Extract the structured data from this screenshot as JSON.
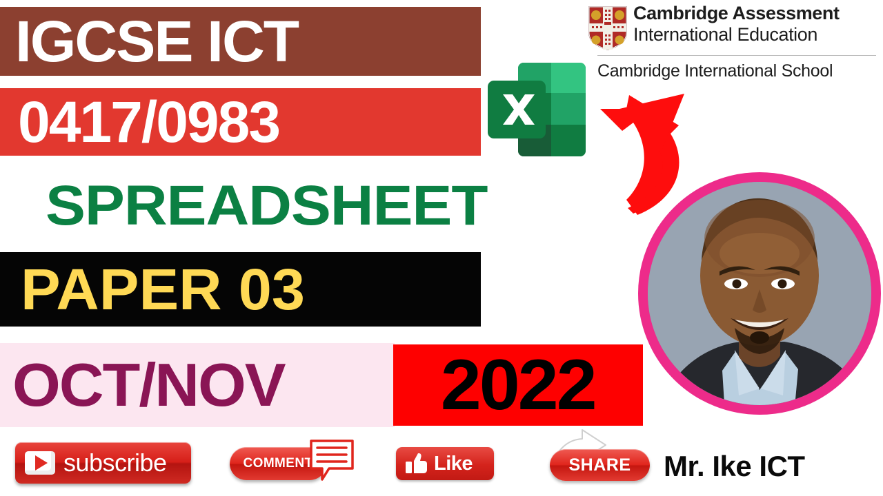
{
  "banners": {
    "course": "IGCSE ICT",
    "syllabus_code": "0417/0983",
    "topic": "SPREADSHEET",
    "paper": "PAPER 03",
    "session": "OCT/NOV",
    "year": "2022"
  },
  "logo": {
    "title_line1": "Cambridge Assessment",
    "title_line2": "International Education",
    "subtitle": "Cambridge International School",
    "crest_icon": "cambridge-crest-icon"
  },
  "excel": {
    "icon_letter": "X",
    "icon_name": "microsoft-excel-icon"
  },
  "arrow": {
    "icon_name": "curved-arrow-icon",
    "color": "#fe0d0d"
  },
  "portrait": {
    "alt": "presenter-portrait",
    "ring_color": "#ed2b8a"
  },
  "social": {
    "subscribe_label": "subscribe",
    "comment_label": "COMMENT",
    "like_label": "Like",
    "share_label": "SHARE",
    "channel_name": "Mr. Ike ICT"
  },
  "colors": {
    "brown": "#8c4030",
    "red": "#e2382f",
    "green": "#0b8043",
    "black": "#050505",
    "yellow": "#ffd955",
    "pink_bg": "#fce6f0",
    "maroon": "#8a1555",
    "bright_red": "#fe0000",
    "magenta": "#ed2b8a"
  }
}
